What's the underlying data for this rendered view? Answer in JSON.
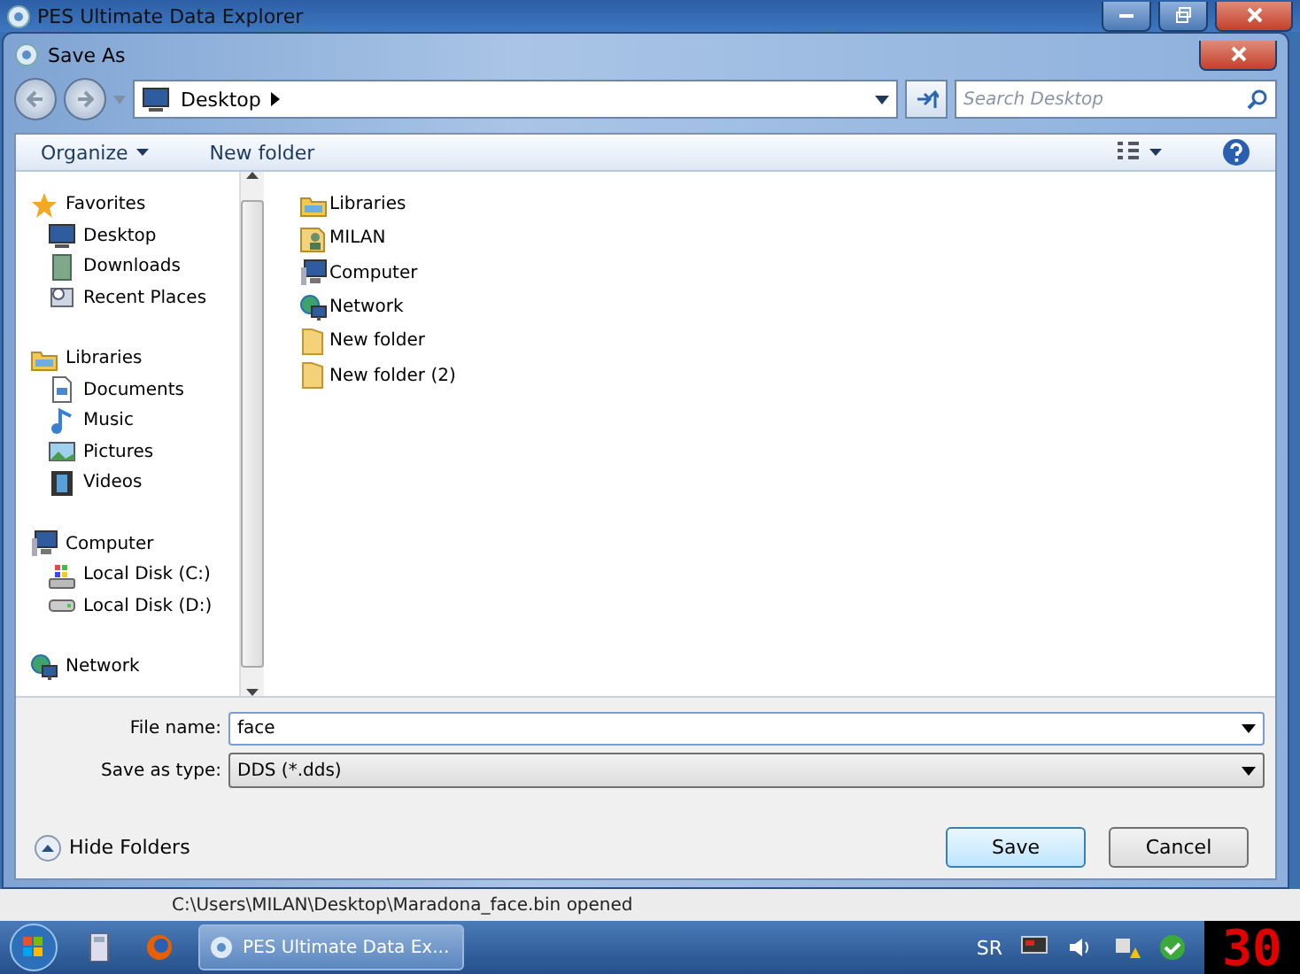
{
  "app_window": {
    "title": "PES Ultimate Data Explorer"
  },
  "dialog": {
    "title": "Save As",
    "address": [
      "Desktop"
    ],
    "search": {
      "placeholder": "Search Desktop"
    },
    "toolbar": [
      {
        "label": "Organize",
        "dropdown": true
      },
      {
        "label": "New folder",
        "dropdown": false
      }
    ],
    "navigation": [
      {
        "label": "Favorites",
        "kind": "star",
        "children": [
          {
            "label": "Desktop",
            "kind": "desktop"
          },
          {
            "label": "Downloads",
            "kind": "downloads"
          },
          {
            "label": "Recent Places",
            "kind": "recent"
          }
        ]
      },
      {
        "label": "Libraries",
        "kind": "library",
        "children": [
          {
            "label": "Documents",
            "kind": "documents"
          },
          {
            "label": "Music",
            "kind": "music"
          },
          {
            "label": "Pictures",
            "kind": "pictures"
          },
          {
            "label": "Videos",
            "kind": "videos"
          }
        ]
      },
      {
        "label": "Computer",
        "kind": "computer",
        "children": [
          {
            "label": "Local Disk (C:)",
            "kind": "system-disk"
          },
          {
            "label": "Local Disk (D:)",
            "kind": "disk"
          }
        ]
      },
      {
        "label": "Network",
        "kind": "network"
      }
    ],
    "files": [
      {
        "name": "Libraries",
        "kind": "library"
      },
      {
        "name": "MILAN",
        "kind": "user"
      },
      {
        "name": "Computer",
        "kind": "computer"
      },
      {
        "name": "Network",
        "kind": "network"
      },
      {
        "name": "New folder",
        "kind": "folder"
      },
      {
        "name": "New folder (2)",
        "kind": "folder"
      }
    ],
    "file_name": {
      "label": "File name:",
      "value": "face"
    },
    "save_as_type": {
      "label": "Save as type:",
      "value": "DDS (*.dds)"
    },
    "hide_folders": "Hide Folders",
    "buttons": [
      {
        "label": "Save",
        "default": true
      },
      {
        "label": "Cancel",
        "default": false
      }
    ]
  },
  "status_bar": "C:\\Users\\MILAN\\Desktop\\Maradona_face.bin opened",
  "taskbar": {
    "task": "PES Ultimate Data Ex...",
    "language": "SR"
  },
  "counter": "30"
}
